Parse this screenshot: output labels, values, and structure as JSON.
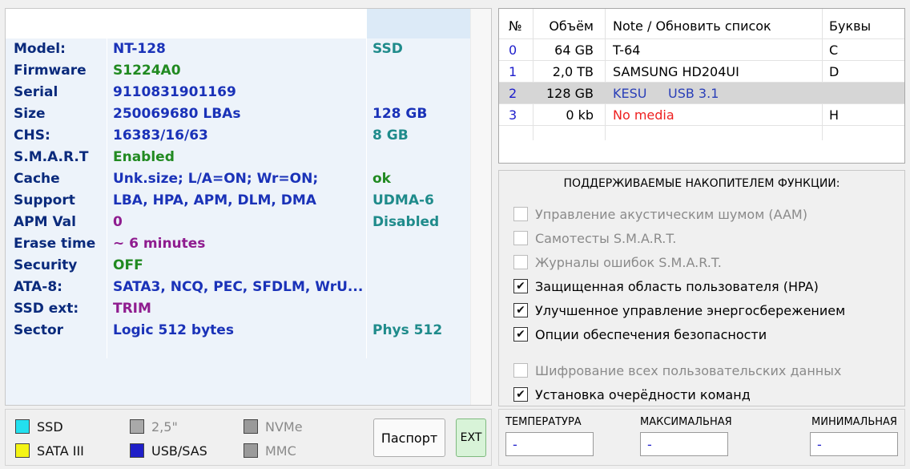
{
  "info": {
    "rows": [
      {
        "key": "Model:",
        "value": "NT-128",
        "extra": "SSD"
      },
      {
        "key": "Firmware",
        "value": "S1224A0",
        "extra": ""
      },
      {
        "key": "Serial",
        "value": "9110831901169",
        "extra": ""
      },
      {
        "key": "Size",
        "value": "250069680 LBAs",
        "extra": "128 GB"
      },
      {
        "key": "CHS:",
        "value": "16383/16/63",
        "extra": "8 GB"
      },
      {
        "key": "S.M.A.R.T",
        "value": "Enabled",
        "extra": ""
      },
      {
        "key": "Cache",
        "value": "Unk.size; L/A=ON; Wr=ON;",
        "extra": "ok"
      },
      {
        "key": "Support",
        "value": "LBA, HPA, APM, DLM, DMA",
        "extra": "UDMA-6"
      },
      {
        "key": "APM Val",
        "value": "0",
        "extra": "Disabled"
      },
      {
        "key": "Erase time",
        "value": "~ 6 minutes",
        "extra": ""
      },
      {
        "key": "Security",
        "value": "OFF",
        "extra": ""
      },
      {
        "key": "ATA-8:",
        "value": "SATA3, NCQ, PEC, SFDLM, WrU...",
        "extra": ""
      },
      {
        "key": "SSD ext:",
        "value": "TRIM",
        "extra": ""
      },
      {
        "key": "Sector",
        "value": "Logic 512 bytes",
        "extra": "Phys 512"
      }
    ]
  },
  "drives": {
    "headers": {
      "num": "№",
      "volume": "Объём",
      "note": "Note / Обновить список",
      "letters": "Буквы"
    },
    "rows": [
      {
        "num": "0",
        "volume": "64 GB",
        "note": "T-64",
        "note2": "",
        "letters": "C"
      },
      {
        "num": "1",
        "volume": "2,0 TB",
        "note": "SAMSUNG HD204UI",
        "note2": "",
        "letters": "D"
      },
      {
        "num": "2",
        "volume": "128 GB",
        "note": "KESU",
        "note2": "USB 3.1",
        "letters": ""
      },
      {
        "num": "3",
        "volume": "0 kb",
        "note": "No media",
        "note2": "",
        "letters": "H"
      }
    ]
  },
  "features": {
    "title": "ПОДДЕРЖИВАЕМЫЕ НАКОПИТЕЛЕМ ФУНКЦИИ:",
    "items": [
      {
        "label": "Управление акустическим шумом (AAM)",
        "checked": false
      },
      {
        "label": "Самотесты S.M.A.R.T.",
        "checked": false
      },
      {
        "label": "Журналы ошибок S.M.A.R.T.",
        "checked": false
      },
      {
        "label": "Защищенная область пользователя (HPA)",
        "checked": true
      },
      {
        "label": "Улучшенное управление энергосбережением",
        "checked": true
      },
      {
        "label": "Опции обеспечения безопасности",
        "checked": true
      },
      {
        "label": "Шифрование всех пользовательских данных",
        "checked": false
      },
      {
        "label": "Установка очерёдности команд",
        "checked": true
      }
    ]
  },
  "legend": {
    "ssd": "SSD",
    "sata": "SATA III",
    "hdd25": "2,5\"",
    "usbsas": "USB/SAS",
    "nvme": "NVMe",
    "mmc": "MMC",
    "colors": {
      "ssd": "#23e0ef",
      "sata": "#f4f414",
      "hdd25": "#a9a9a9",
      "usbsas": "#1f1fc8",
      "nvme": "#9a9a9a",
      "mmc": "#9a9a9a"
    }
  },
  "buttons": {
    "passport": "Паспорт",
    "ext": "EXT"
  },
  "temps": {
    "temp_label": "ТЕМПЕРАТУРА",
    "max_label": "МАКСИМАЛЬНАЯ",
    "min_label": "МИНИМАЛЬНАЯ",
    "temp_value": "-",
    "max_value": "-",
    "min_value": "-"
  }
}
